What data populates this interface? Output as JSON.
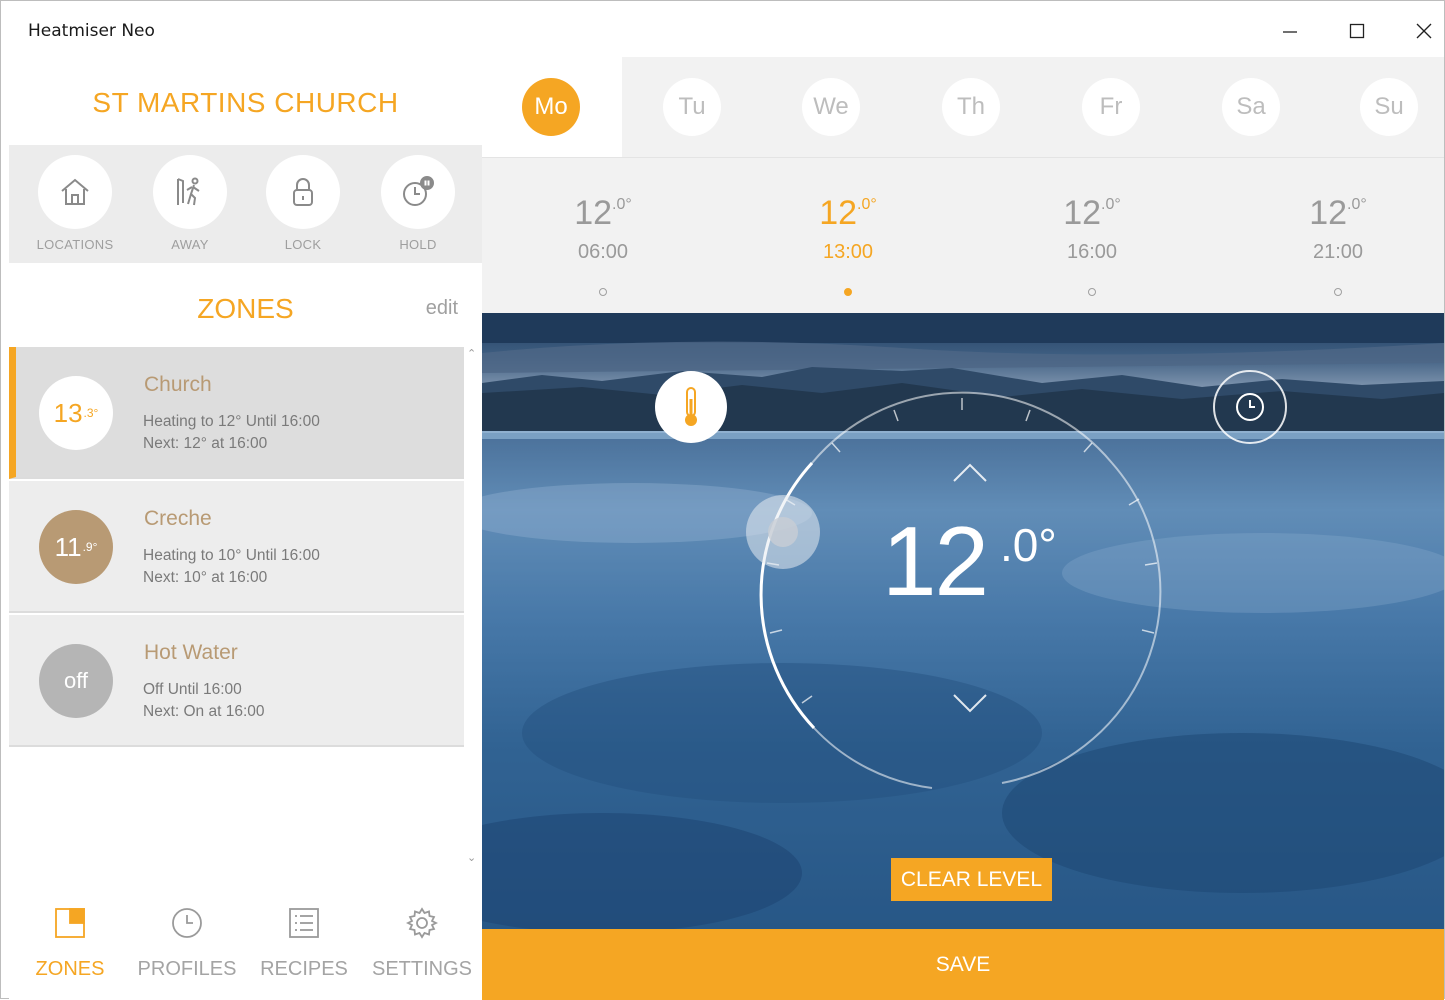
{
  "window": {
    "title": "Heatmiser Neo"
  },
  "location": {
    "title": "ST MARTINS CHURCH"
  },
  "quick_actions": [
    {
      "label": "LOCATIONS",
      "icon": "home-icon"
    },
    {
      "label": "AWAY",
      "icon": "away-walking-icon"
    },
    {
      "label": "LOCK",
      "icon": "lock-icon"
    },
    {
      "label": "HOLD",
      "icon": "hold-clock-icon"
    }
  ],
  "zones": {
    "title": "ZONES",
    "edit_label": "edit",
    "items": [
      {
        "name": "Church",
        "temp_int": "13",
        "temp_dec": ".3°",
        "line1": "Heating to 12° Until 16:00",
        "line2": "Next: 12° at 16:00"
      },
      {
        "name": "Creche",
        "temp_int": "11",
        "temp_dec": ".9°",
        "line1": "Heating to 10° Until 16:00",
        "line2": "Next: 10° at 16:00"
      },
      {
        "name": "Hot Water",
        "temp_int": "off",
        "temp_dec": "",
        "line1": "Off Until 16:00",
        "line2": "Next: On at 16:00"
      }
    ]
  },
  "bottom_nav": [
    {
      "label": "ZONES",
      "icon": "zones-icon"
    },
    {
      "label": "PROFILES",
      "icon": "clock-icon"
    },
    {
      "label": "RECIPES",
      "icon": "list-icon"
    },
    {
      "label": "SETTINGS",
      "icon": "gear-icon"
    }
  ],
  "days": [
    "Mo",
    "Tu",
    "We",
    "Th",
    "Fr",
    "Sa",
    "Su"
  ],
  "active_day": "Mo",
  "schedule": [
    {
      "temp": "12",
      "dec": ".0°",
      "time": "06:00"
    },
    {
      "temp": "12",
      "dec": ".0°",
      "time": "13:00"
    },
    {
      "temp": "12",
      "dec": ".0°",
      "time": "16:00"
    },
    {
      "temp": "12",
      "dec": ".0°",
      "time": "21:00"
    }
  ],
  "dial": {
    "setpoint": "12",
    "setpoint_dec": ".0°"
  },
  "buttons": {
    "clear_level": "CLEAR LEVEL",
    "save": "SAVE"
  },
  "colors": {
    "accent": "#f5a623",
    "creche_circle": "#b89a74",
    "off_circle": "#b5b5b5"
  }
}
